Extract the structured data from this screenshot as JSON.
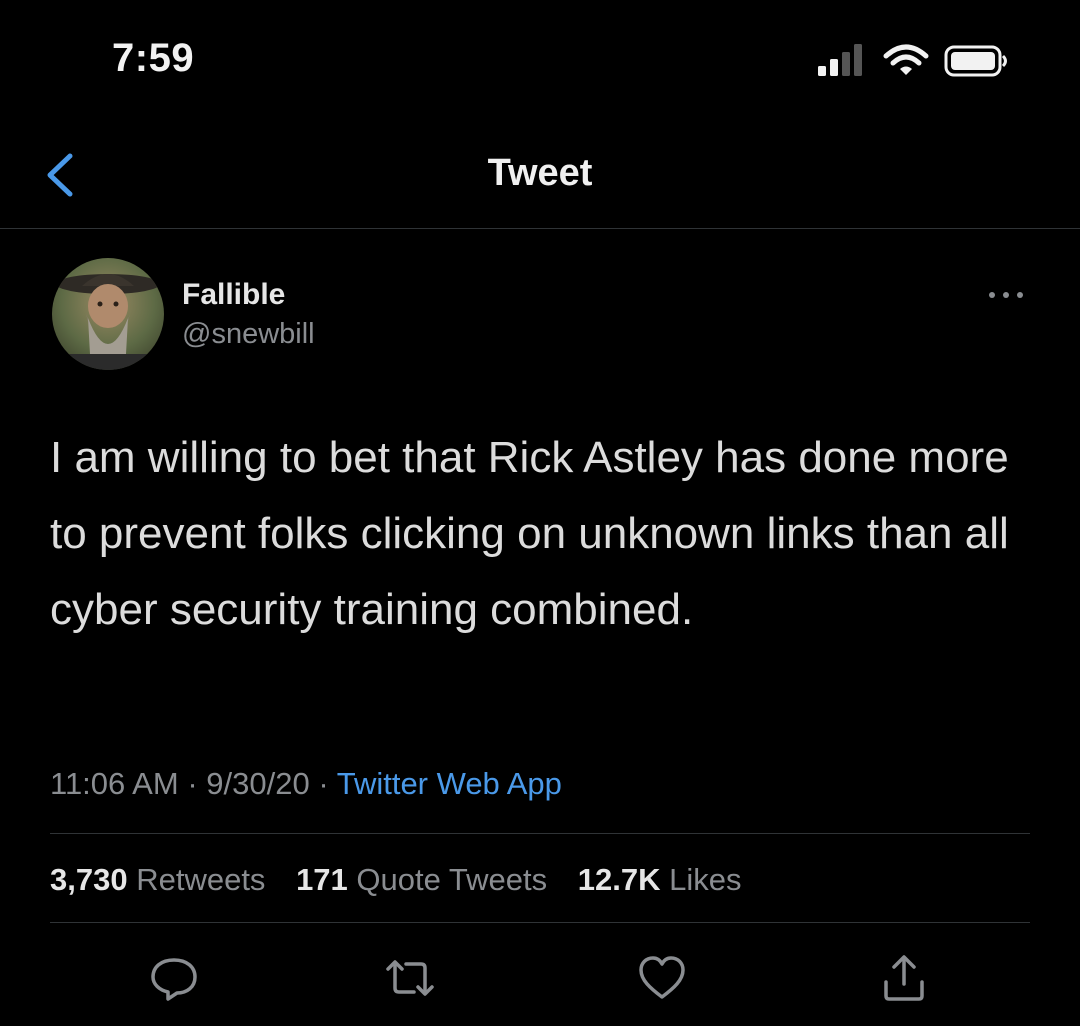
{
  "status_bar": {
    "time": "7:59",
    "icons": [
      "cellular-signal-icon",
      "wifi-icon",
      "battery-icon"
    ]
  },
  "nav": {
    "back_icon": "chevron-left-icon",
    "title": "Tweet"
  },
  "tweet": {
    "author": {
      "name": "Fallible",
      "handle": "@snewbill",
      "avatar": "avatar-photo"
    },
    "more_icon": "more-dots-icon",
    "text": "I am willing to bet that Rick Astley has done more to prevent folks clicking on unknown links than all cyber security training combined.",
    "time": "11:06 AM",
    "date": "9/30/20",
    "separator": "·",
    "source": "Twitter Web App",
    "stats": {
      "retweets": {
        "count": "3,730",
        "label": "Retweets"
      },
      "quotes": {
        "count": "171",
        "label": "Quote Tweets"
      },
      "likes": {
        "count": "12.7K",
        "label": "Likes"
      }
    },
    "actions": [
      "reply-icon",
      "retweet-icon",
      "like-icon",
      "share-icon"
    ]
  },
  "colors": {
    "background": "#000000",
    "link": "#4a99e9",
    "secondary_text": "#8a8d91",
    "divider": "#2f3336"
  }
}
